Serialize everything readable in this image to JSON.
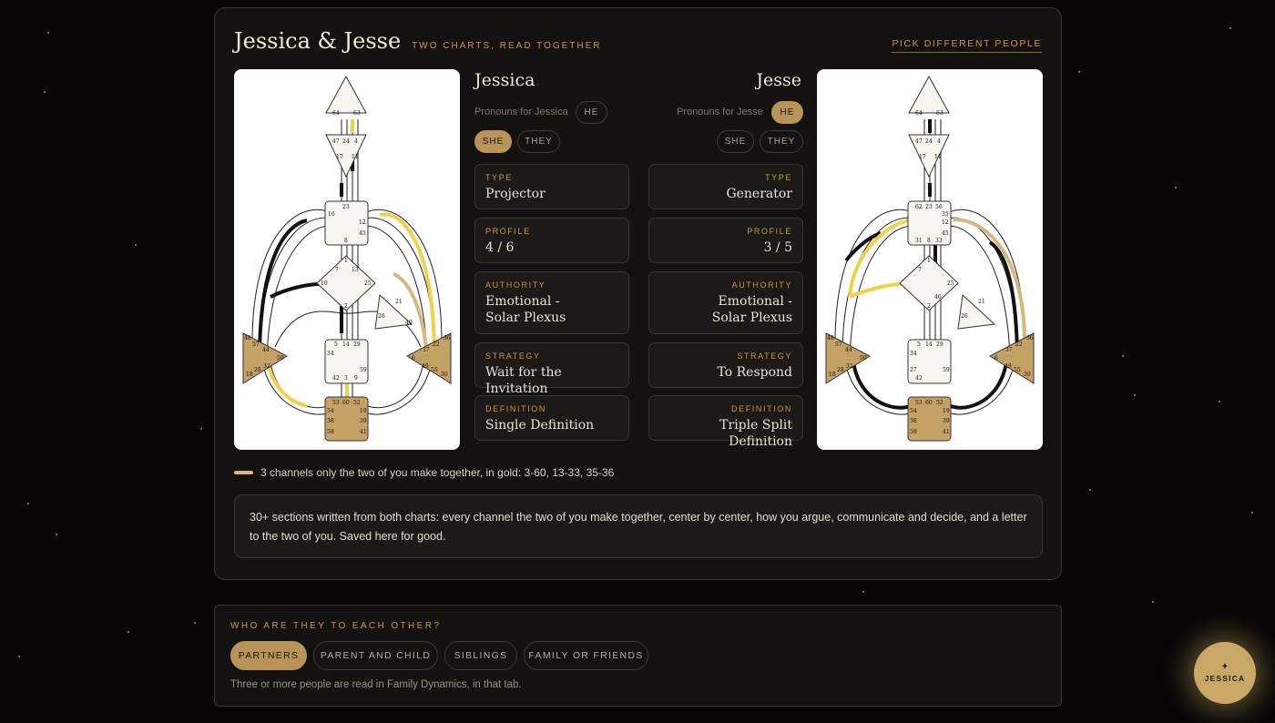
{
  "header": {
    "title": "Jessica & Jesse",
    "subtitle": "TWO CHARTS, READ TOGETHER",
    "pick_label": "PICK DIFFERENT PEOPLE"
  },
  "people": {
    "left": {
      "name": "Jessica",
      "pronouns_label": "Pronouns for Jessica",
      "pronouns": [
        "HE",
        "SHE",
        "THEY"
      ],
      "selected_pronoun": "SHE",
      "fields": [
        {
          "label": "TYPE",
          "value": "Projector"
        },
        {
          "label": "PROFILE",
          "value": "4 / 6"
        },
        {
          "label": "AUTHORITY",
          "value": "Emotional - Solar Plexus"
        },
        {
          "label": "STRATEGY",
          "value": "Wait for the Invitation"
        },
        {
          "label": "DEFINITION",
          "value": "Single Definition"
        }
      ],
      "gates": {
        "head": [
          "64",
          "63"
        ],
        "ajna": [
          "47",
          "24",
          "4",
          "17",
          "11"
        ],
        "throat": [
          "23",
          "16",
          "12",
          "45",
          "8"
        ],
        "g": [
          "1",
          "7",
          "13",
          "10",
          "25",
          "2"
        ],
        "heart": [
          "21",
          "26",
          "40"
        ],
        "sacral": [
          "5",
          "14",
          "29",
          "34",
          "59",
          "42",
          "3",
          "9"
        ],
        "root": [
          "53",
          "60",
          "52",
          "54",
          "19",
          "38",
          "39",
          "58",
          "41"
        ],
        "spleen": [
          "48",
          "57",
          "44",
          "50",
          "32",
          "28",
          "18"
        ],
        "solar": [
          "36",
          "22",
          "37",
          "6",
          "49",
          "55",
          "30"
        ]
      }
    },
    "right": {
      "name": "Jesse",
      "pronouns_label": "Pronouns for Jesse",
      "pronouns": [
        "HE",
        "SHE",
        "THEY"
      ],
      "selected_pronoun": "HE",
      "fields": [
        {
          "label": "TYPE",
          "value": "Generator"
        },
        {
          "label": "PROFILE",
          "value": "3 / 5"
        },
        {
          "label": "AUTHORITY",
          "value": "Emotional - Solar Plexus"
        },
        {
          "label": "STRATEGY",
          "value": "To Respond"
        },
        {
          "label": "DEFINITION",
          "value": "Triple Split Definition"
        }
      ],
      "gates": {
        "head": [
          "64",
          "63"
        ],
        "ajna": [
          "47",
          "24",
          "4",
          "17",
          "11"
        ],
        "throat": [
          "62",
          "23",
          "56",
          "35",
          "12",
          "45",
          "31",
          "8",
          "33"
        ],
        "g": [
          "1",
          "7",
          "46",
          "25",
          "2"
        ],
        "heart": [
          "21",
          "26"
        ],
        "sacral": [
          "5",
          "14",
          "29",
          "34",
          "27",
          "59",
          "42"
        ],
        "root": [
          "53",
          "60",
          "52",
          "54",
          "19",
          "38",
          "39",
          "58",
          "41"
        ],
        "spleen": [
          "48",
          "57",
          "44",
          "50",
          "32",
          "18",
          "28"
        ],
        "solar": [
          "36",
          "22",
          "37",
          "6",
          "49",
          "55",
          "30"
        ]
      }
    }
  },
  "legend_text": "3 channels only the two of you make together, in gold: 3-60, 13-33, 35-36",
  "note_text": "30+ sections written from both charts: every channel the two of you make together, center by center, how you argue, communicate and decide, and a letter to the two of you. Saved here for good.",
  "relationship": {
    "heading": "WHO ARE THEY TO EACH OTHER?",
    "options": [
      "PARTNERS",
      "PARENT AND CHILD",
      "SIBLINGS",
      "FAMILY OR FRIENDS"
    ],
    "selected": "PARTNERS",
    "note": "Three or more people are read in Family Dynamics, in that tab."
  },
  "fab": {
    "icon": "sparkle-icon",
    "label": "JESSICA"
  },
  "colors": {
    "gold": "#b89458",
    "accent_text": "#c49a4c",
    "defined_center": "#c4a165",
    "background": "#070605",
    "panel": "#131210"
  }
}
